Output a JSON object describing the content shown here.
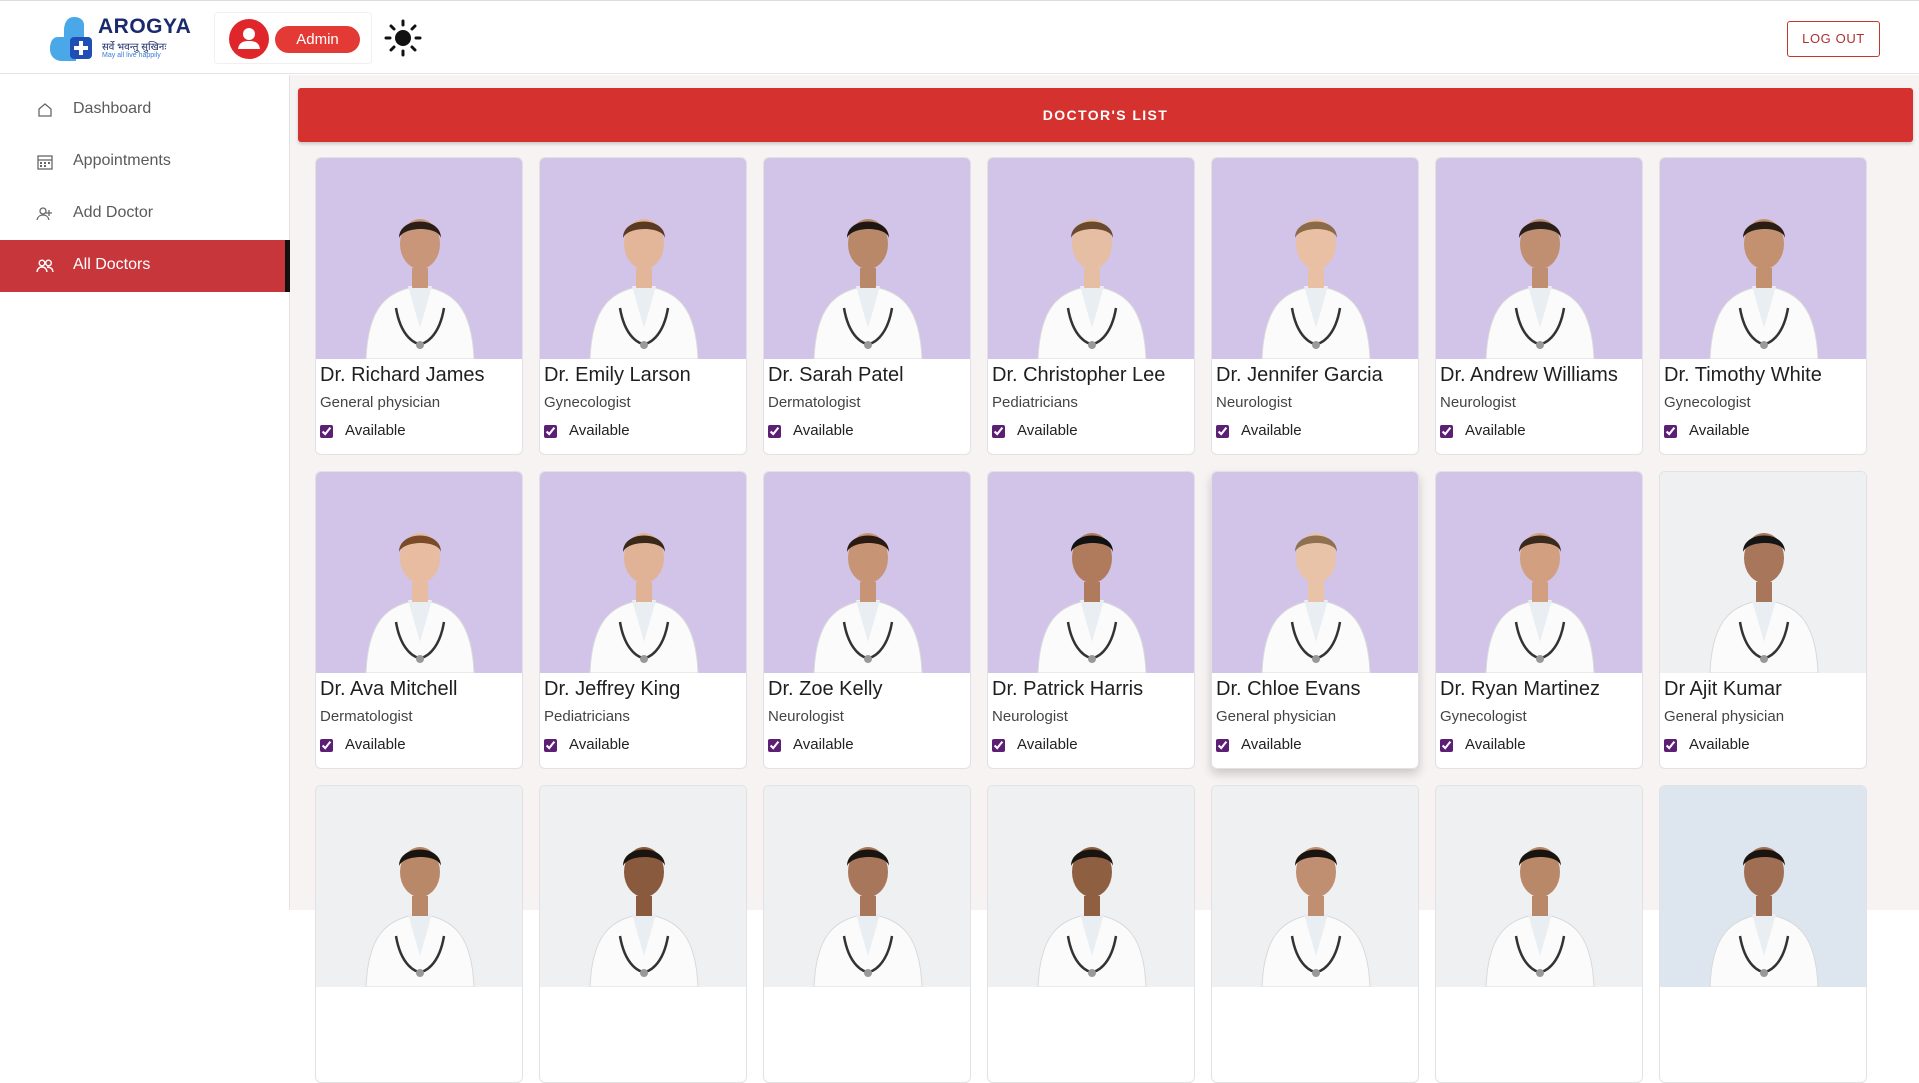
{
  "header": {
    "logo_title": "AROGYA",
    "logo_tagline": "सर्वे भवन्तु सुखिनः",
    "logo_subtagline": "May all live happily",
    "admin_label": "Admin",
    "logout_label": "LOG OUT"
  },
  "sidebar": {
    "items": [
      {
        "label": "Dashboard",
        "icon": "home-icon",
        "active": false
      },
      {
        "label": "Appointments",
        "icon": "calendar-icon",
        "active": false
      },
      {
        "label": "Add Doctor",
        "icon": "add-user-icon",
        "active": false
      },
      {
        "label": "All Doctors",
        "icon": "users-icon",
        "active": true
      }
    ]
  },
  "main": {
    "banner_title": "DOCTOR'S LIST",
    "availability_label": "Available",
    "doctors": [
      {
        "name": "Dr. Richard James",
        "speciality": "General physician",
        "available": true,
        "photo_bg": "purple"
      },
      {
        "name": "Dr. Emily Larson",
        "speciality": "Gynecologist",
        "available": true,
        "photo_bg": "purple"
      },
      {
        "name": "Dr. Sarah Patel",
        "speciality": "Dermatologist",
        "available": true,
        "photo_bg": "purple"
      },
      {
        "name": "Dr. Christopher Lee",
        "speciality": "Pediatricians",
        "available": true,
        "photo_bg": "purple"
      },
      {
        "name": "Dr. Jennifer Garcia",
        "speciality": "Neurologist",
        "available": true,
        "photo_bg": "purple"
      },
      {
        "name": "Dr. Andrew Williams",
        "speciality": "Neurologist",
        "available": true,
        "photo_bg": "purple"
      },
      {
        "name": "Dr. Timothy White",
        "speciality": "Gynecologist",
        "available": true,
        "photo_bg": "purple"
      },
      {
        "name": "Dr. Ava Mitchell",
        "speciality": "Dermatologist",
        "available": true,
        "photo_bg": "purple"
      },
      {
        "name": "Dr. Jeffrey King",
        "speciality": "Pediatricians",
        "available": true,
        "photo_bg": "purple"
      },
      {
        "name": "Dr. Zoe Kelly",
        "speciality": "Neurologist",
        "available": true,
        "photo_bg": "purple"
      },
      {
        "name": "Dr. Patrick Harris",
        "speciality": "Neurologist",
        "available": true,
        "photo_bg": "purple"
      },
      {
        "name": "Dr. Chloe Evans",
        "speciality": "General physician",
        "available": true,
        "photo_bg": "purple"
      },
      {
        "name": "Dr. Ryan Martinez",
        "speciality": "Gynecologist",
        "available": true,
        "photo_bg": "purple"
      },
      {
        "name": "Dr Ajit Kumar",
        "speciality": "General physician",
        "available": true,
        "photo_bg": "white"
      }
    ],
    "partial_row_photo_bgs": [
      "white",
      "white",
      "white",
      "white",
      "white",
      "white",
      "blue"
    ]
  },
  "colors": {
    "accent_red": "#d5322f",
    "active_nav": "#c6363a",
    "photo_purple": "#d2c4e8",
    "checkbox": "#5b1f74"
  }
}
